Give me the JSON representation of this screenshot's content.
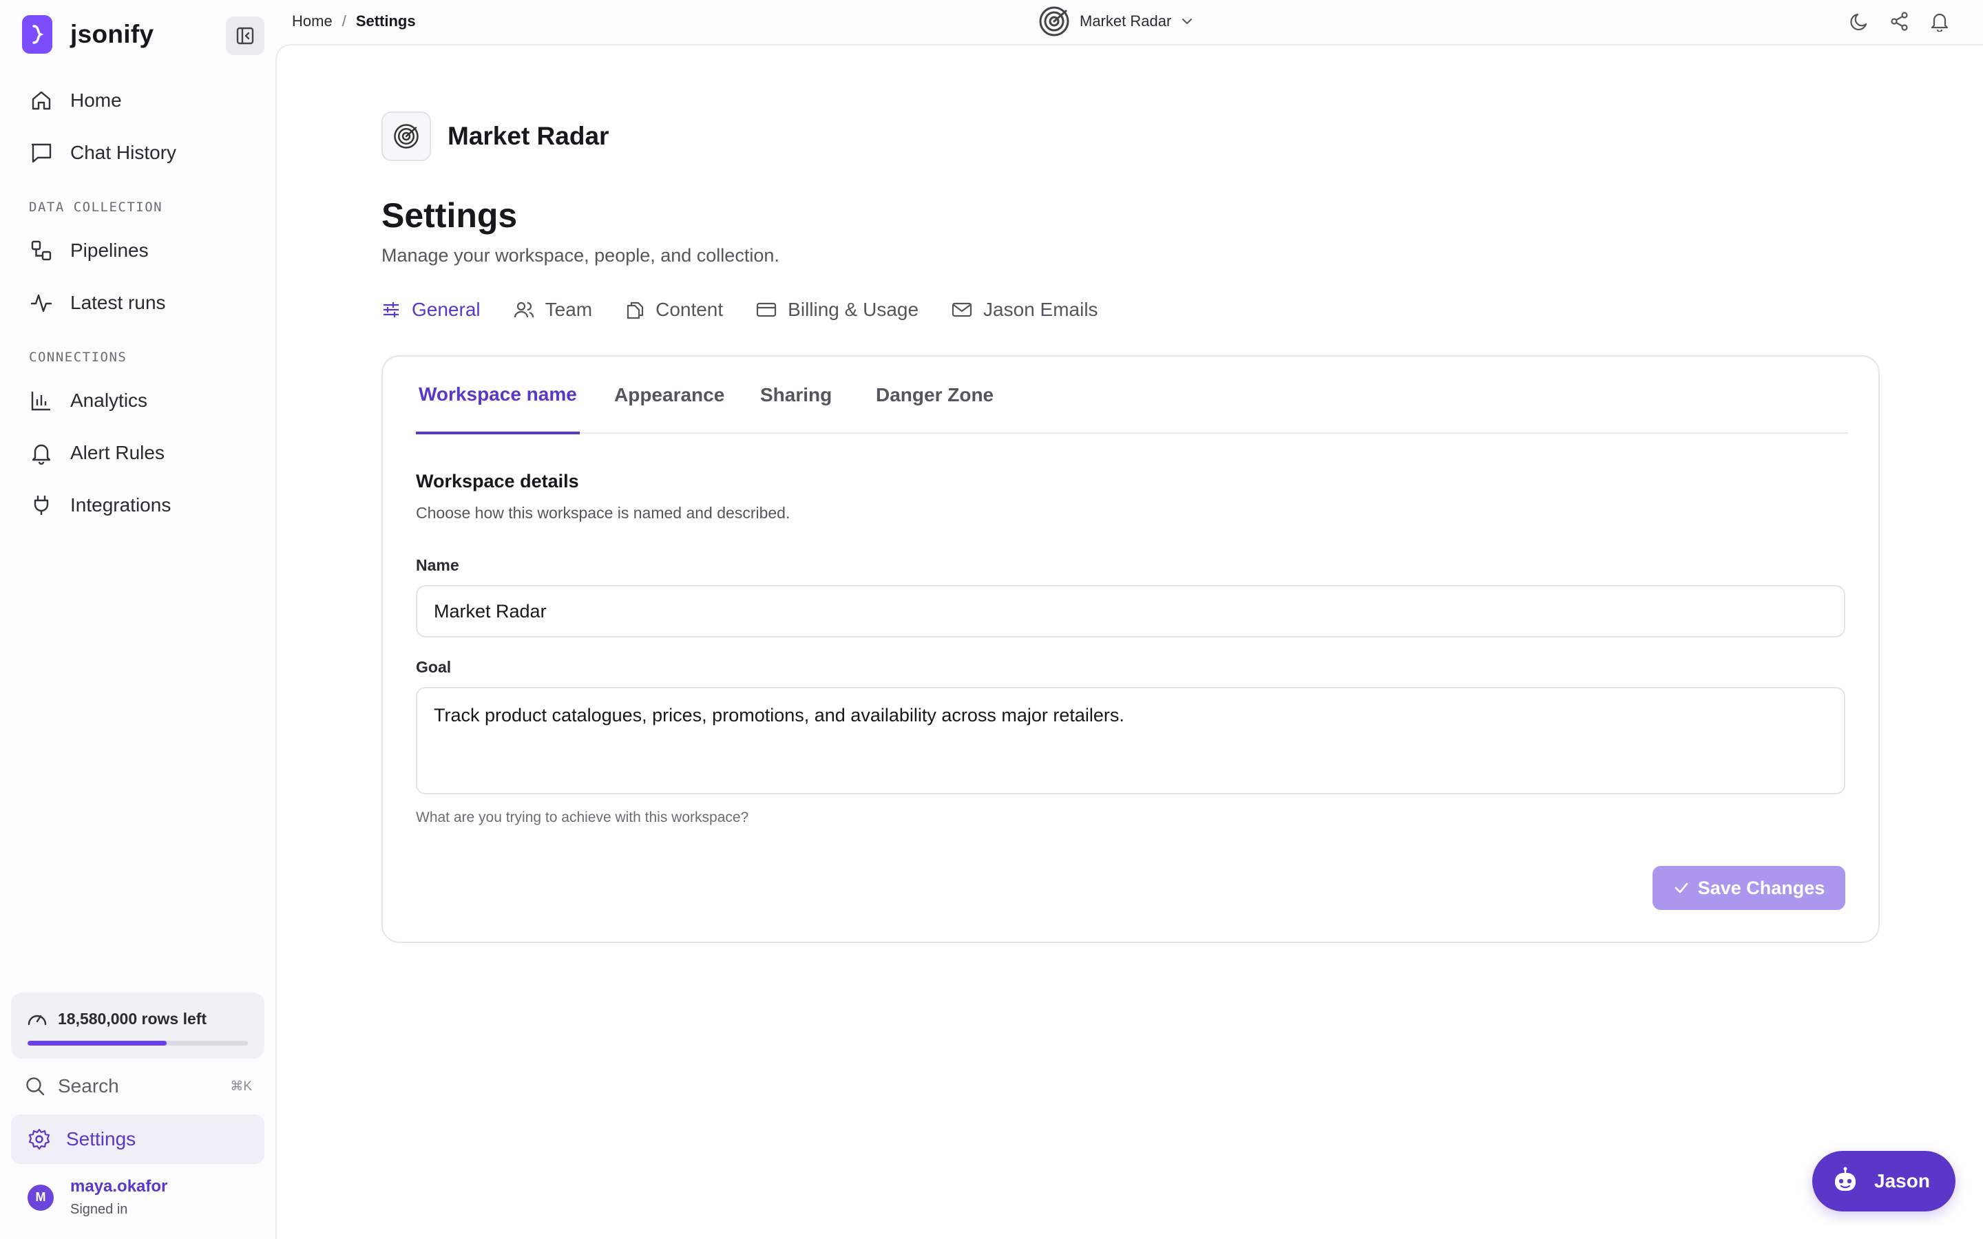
{
  "app": {
    "name": "jsonify"
  },
  "sidebar": {
    "primary": [
      {
        "label": "Home",
        "icon": "home-icon"
      },
      {
        "label": "Chat History",
        "icon": "chat-icon"
      }
    ],
    "sections": [
      {
        "label": "DATA COLLECTION",
        "items": [
          {
            "label": "Pipelines",
            "icon": "pipeline-icon"
          },
          {
            "label": "Latest runs",
            "icon": "activity-icon"
          }
        ]
      },
      {
        "label": "CONNECTIONS",
        "items": [
          {
            "label": "Analytics",
            "icon": "bar-chart-icon"
          },
          {
            "label": "Alert Rules",
            "icon": "bell-icon"
          },
          {
            "label": "Integrations",
            "icon": "plug-icon"
          }
        ]
      }
    ],
    "usage": {
      "text": "18,580,000 rows left",
      "fraction": 0.63
    },
    "search": {
      "label": "Search",
      "shortcut": "⌘K"
    },
    "settings": {
      "label": "Settings"
    },
    "user": {
      "initial": "M",
      "name": "maya.okafor",
      "status": "Signed in"
    }
  },
  "topbar": {
    "breadcrumb": {
      "home": "Home",
      "separator": "/",
      "current": "Settings"
    },
    "workspace": "Market Radar"
  },
  "main": {
    "workspace_name": "Market Radar",
    "title": "Settings",
    "subtitle": "Manage your workspace, people, and collection.",
    "tabs": [
      {
        "label": "General",
        "icon": "sliders-icon",
        "active": true
      },
      {
        "label": "Team",
        "icon": "users-icon"
      },
      {
        "label": "Content",
        "icon": "files-icon"
      },
      {
        "label": "Billing & Usage",
        "icon": "credit-card-icon"
      },
      {
        "label": "Jason Emails",
        "icon": "mail-icon"
      }
    ],
    "subtabs": [
      {
        "label": "Workspace name",
        "active": true
      },
      {
        "label": "Appearance"
      },
      {
        "label": "Sharing"
      },
      {
        "label": "Danger Zone"
      }
    ],
    "section": {
      "title": "Workspace details",
      "description": "Choose how this workspace is named and described."
    },
    "fields": {
      "name": {
        "label": "Name",
        "value": "Market Radar"
      },
      "goal": {
        "label": "Goal",
        "value": "Track product catalogues, prices, promotions, and availability across major retailers.",
        "help": "What are you trying to achieve with this workspace?"
      }
    },
    "save_label": "Save Changes"
  },
  "assistant": {
    "label": "Jason"
  },
  "colors": {
    "accent": "#5a37c9",
    "brand": "#7c4dff",
    "save_disabled": "#ad96ee"
  }
}
